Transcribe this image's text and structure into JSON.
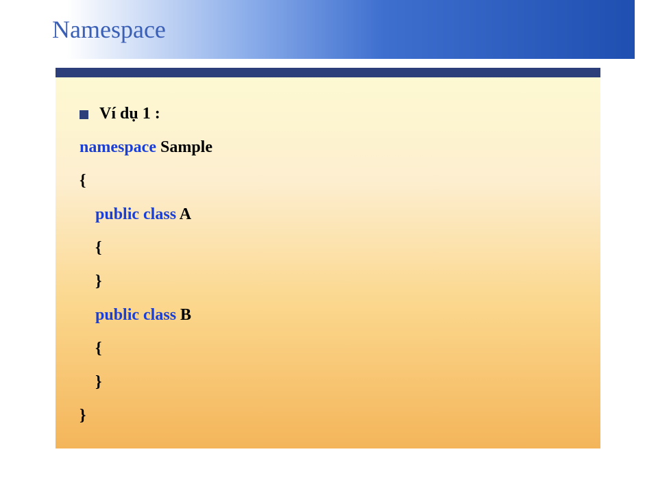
{
  "title": "Namespace",
  "bullet": "Ví dụ 1 :",
  "line1_kw": "namespace",
  "line1_rest": "  Sample",
  "line2": "{",
  "line3_kw": "public class",
  "line3_rest": " A",
  "line4": "{",
  "line5": "}",
  "line6_kw": "public class",
  "line6_rest": " B",
  "line7": "{",
  "line8": "}",
  "line9": "}"
}
